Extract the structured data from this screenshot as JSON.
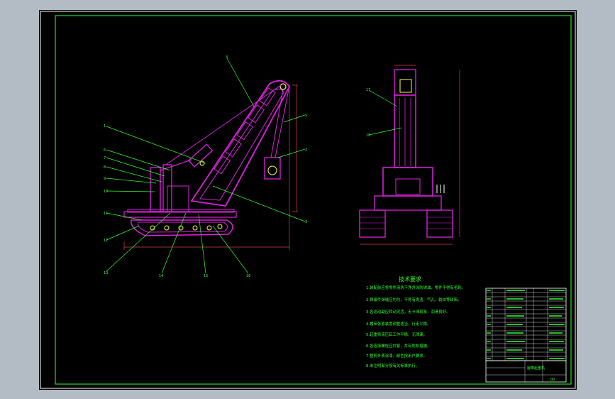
{
  "viewport": {
    "background": "#b3bcc5"
  },
  "colors": {
    "paper": "#000000",
    "frame_white": "#ffffff",
    "border_green": "#22e022",
    "magenta": "#e020e0",
    "green": "#33ff33",
    "yellow": "#ffff33",
    "white": "#ffffff",
    "dim_red": "#d84040"
  },
  "drawing": {
    "leader_numbers_side": [
      "1",
      "2",
      "3",
      "4",
      "5",
      "6",
      "7",
      "8",
      "9",
      "10",
      "11",
      "12",
      "13",
      "14",
      "15",
      "16"
    ],
    "leader_numbers_front": [
      "17",
      "18"
    ],
    "tech_requirements_title": "技术要求",
    "tech_requirements": [
      "1.装配前应将零件清洗干净并涂防锈油，零件不得有毛刺。",
      "2.焊接件焊缝应均匀，不得有夹渣、气孔、裂纹等缺陷。",
      "3.各运动副应转动灵活，无卡滞现象，润滑良好。",
      "4.履带张紧装置调整适当，行走平稳。",
      "5.起重臂液压缸工作平稳，无泄漏。",
      "6.各连接螺栓应拧紧，并有防松措施。",
      "7.整机外表涂漆，颜色按用户要求。",
      "8.未注明部分按有关标准执行。"
    ],
    "title_block": {
      "title": "履带起重机",
      "drawing_no": "00"
    }
  }
}
